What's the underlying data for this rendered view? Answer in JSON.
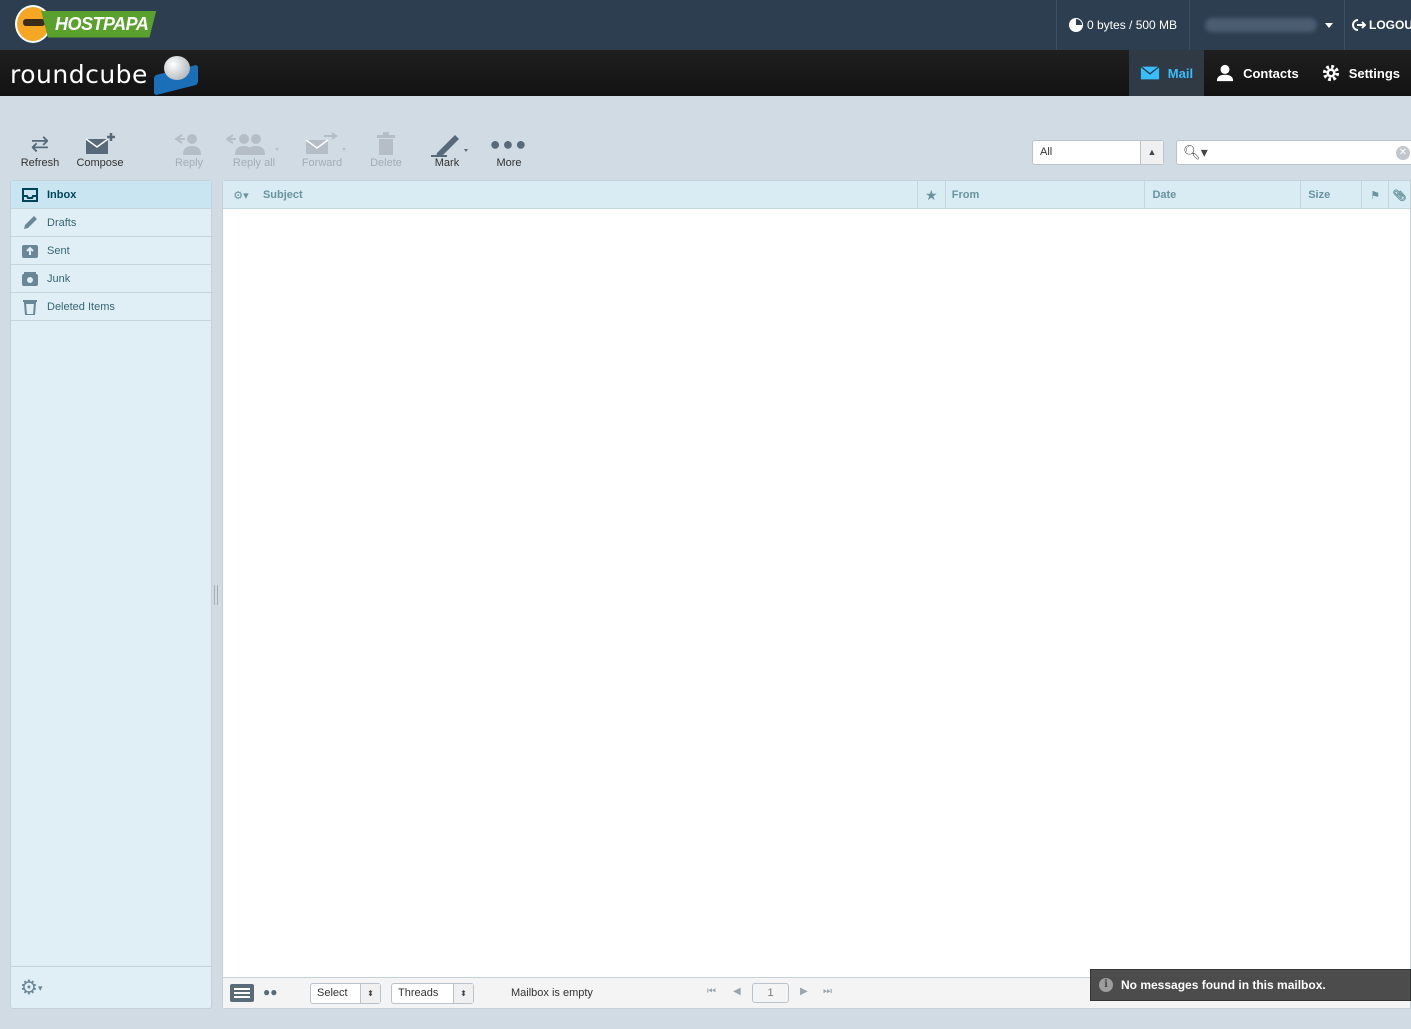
{
  "hostbar": {
    "brand": "HOSTPAPA",
    "quota": "0 bytes / 500 MB",
    "logout_label": "LOGOUT"
  },
  "app": {
    "brand": "roundcube",
    "tasks": [
      {
        "label": "Mail",
        "icon": "envelope-icon",
        "active": true
      },
      {
        "label": "Contacts",
        "icon": "person-icon"
      },
      {
        "label": "Settings",
        "icon": "gear-icon"
      }
    ],
    "accent": "#37beff"
  },
  "toolbar": {
    "refresh": "Refresh",
    "compose": "Compose",
    "reply": "Reply",
    "reply_all": "Reply all",
    "forward": "Forward",
    "delete": "Delete",
    "mark": "Mark",
    "more": "More"
  },
  "filter": {
    "selected": "All"
  },
  "search": {
    "placeholder": ""
  },
  "folders": [
    {
      "name": "Inbox",
      "icon": "inbox-icon",
      "active": true
    },
    {
      "name": "Drafts",
      "icon": "pencil-icon"
    },
    {
      "name": "Sent",
      "icon": "sent-icon"
    },
    {
      "name": "Junk",
      "icon": "junk-icon"
    },
    {
      "name": "Deleted Items",
      "icon": "trash-icon"
    }
  ],
  "list": {
    "columns": {
      "subject": "Subject",
      "from": "From",
      "date": "Date",
      "size": "Size"
    },
    "footer": {
      "select_label": "Select",
      "threads_label": "Threads",
      "status": "Mailbox is empty",
      "page": "1"
    }
  },
  "notice": "No messages found in this mailbox."
}
